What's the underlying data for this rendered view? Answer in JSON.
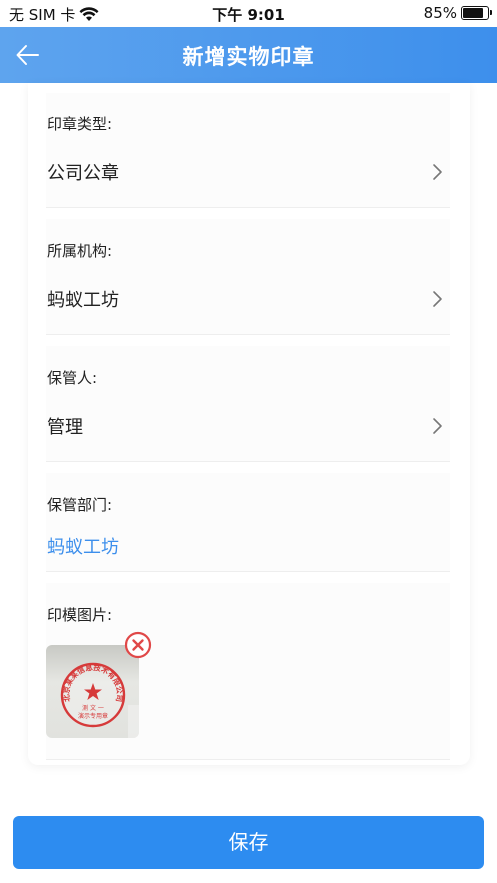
{
  "status_bar": {
    "carrier": "无 SIM 卡",
    "time": "下午 9:01",
    "battery_text": "85%",
    "battery_level": 0.85
  },
  "header": {
    "title": "新增实物印章",
    "back_icon": "arrow-left-icon"
  },
  "form": {
    "seal_type": {
      "label": "印章类型:",
      "value": "公司公章"
    },
    "organization": {
      "label": "所属机构:",
      "value": "蚂蚁工坊"
    },
    "custodian": {
      "label": "保管人:",
      "value": "管理"
    },
    "custodian_dept": {
      "label": "保管部门:",
      "value": "蚂蚁工坊"
    },
    "seal_image": {
      "label": "印模图片:"
    }
  },
  "seal_text": {
    "arc": "北京某某信息技术有限公司",
    "line1": "测 文 一",
    "line2": "演示专用章"
  },
  "colors": {
    "primary": "#2d8cf0",
    "header_gradient_start": "#5ea4ee",
    "header_gradient_end": "#3d8fec",
    "seal_red": "#d63a3a",
    "remove_red": "#e04848"
  },
  "footer": {
    "save_label": "保存"
  }
}
